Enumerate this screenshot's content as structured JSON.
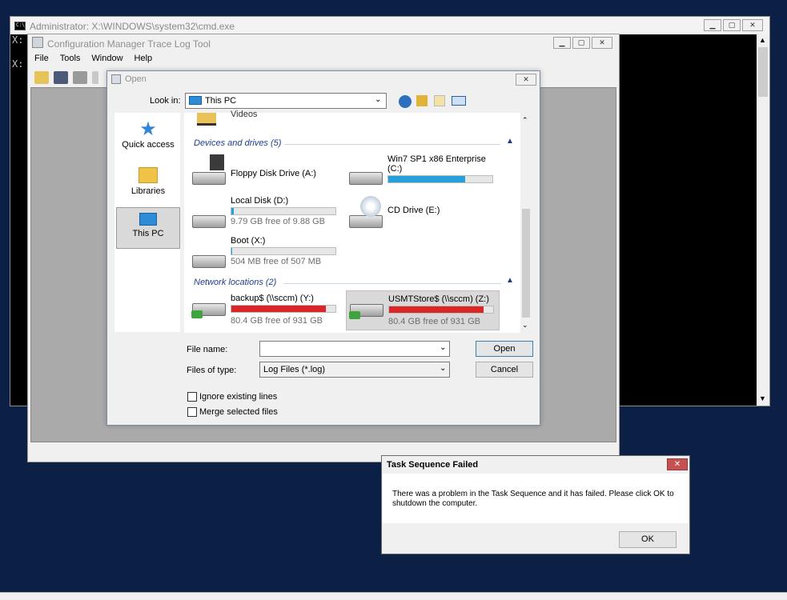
{
  "cmd": {
    "title": "Administrator: X:\\WINDOWS\\system32\\cmd.exe",
    "lines": [
      "X:",
      "X:"
    ]
  },
  "trace_tool": {
    "title": "Configuration Manager Trace Log Tool",
    "menu": [
      "File",
      "Tools",
      "Window",
      "Help"
    ]
  },
  "open_dialog": {
    "title": "Open",
    "look_in_label": "Look in:",
    "look_in_value": "This PC",
    "places": [
      {
        "label": "Quick access",
        "icon": "star-icon"
      },
      {
        "label": "Libraries",
        "icon": "folder-icon"
      },
      {
        "label": "This PC",
        "icon": "computer-icon",
        "selected": true
      }
    ],
    "partial_item": "Videos",
    "groups": {
      "devices": "Devices and drives (5)",
      "network": "Network locations (2)"
    },
    "drives": [
      {
        "name": "Floppy Disk Drive (A:)",
        "free_text": "",
        "fill": 0
      },
      {
        "name": "Win7 SP1 x86 Enterprise\n(C:)",
        "free_text": "",
        "fill": 0.74,
        "color": "#26a0da"
      },
      {
        "name": "Local Disk (D:)",
        "free_text": "9.79 GB free of 9.88 GB",
        "fill": 0.01,
        "color": "#26a0da"
      },
      {
        "name": "CD Drive (E:)",
        "free_text": "",
        "fill": 0
      },
      {
        "name": "Boot (X:)",
        "free_text": "504 MB free of 507 MB",
        "fill": 0.01,
        "color": "#26a0da"
      }
    ],
    "network": [
      {
        "name": "backup$ (\\\\sccm) (Y:)",
        "free_text": "80.4 GB free of 931 GB",
        "fill": 0.91,
        "color": "#da2626"
      },
      {
        "name": "USMTStore$ (\\\\sccm) (Z:)",
        "free_text": "80.4 GB free of 931 GB",
        "fill": 0.91,
        "color": "#da2626",
        "selected": true
      }
    ],
    "file_name_label": "File name:",
    "file_name_value": "",
    "file_type_label": "Files of type:",
    "file_type_value": "Log Files (*.log)",
    "open_button": "Open",
    "cancel_button": "Cancel",
    "ignore_lines": "Ignore existing lines",
    "merge_files": "Merge selected files"
  },
  "ts_dialog": {
    "title": "Task Sequence Failed",
    "message": "There was a problem in the Task Sequence and it has failed. Please click OK to shutdown the computer.",
    "ok": "OK"
  }
}
